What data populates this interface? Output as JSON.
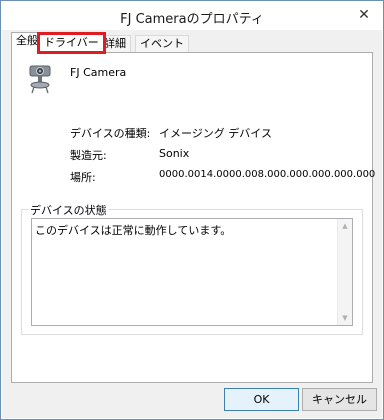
{
  "window": {
    "title": "FJ Cameraのプロパティ",
    "close_glyph": "✕"
  },
  "tabs": [
    {
      "label": "全般",
      "active": true
    },
    {
      "label": "ドライバー",
      "highlighted": true
    },
    {
      "label": "詳細"
    },
    {
      "label": "イベント"
    }
  ],
  "device": {
    "icon": "webcam-icon",
    "name": "FJ Camera"
  },
  "properties": [
    {
      "label": "デバイスの種類:",
      "value": "イメージング デバイス"
    },
    {
      "label": "製造元:",
      "value": "Sonix"
    },
    {
      "label": "場所:",
      "value": "0000.0014.0000.008.000.000.000.000.000"
    }
  ],
  "status": {
    "legend": "デバイスの状態",
    "text": "このデバイスは正常に動作しています。"
  },
  "buttons": {
    "ok": "OK",
    "cancel": "キャンセル"
  },
  "colors": {
    "highlight": "#e01b24",
    "window_border": "#6d8fb3"
  }
}
